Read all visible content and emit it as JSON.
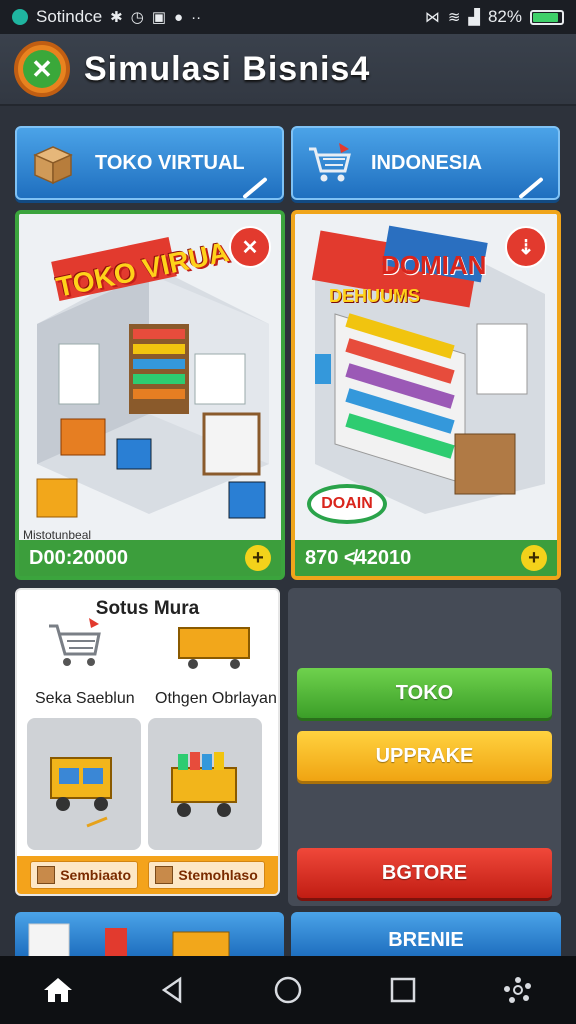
{
  "status_bar": {
    "app_name": "Sotindce",
    "battery_percent": "82%",
    "battery_level": 0.82
  },
  "app": {
    "title": "Simulasi Bisnis4"
  },
  "tabs": [
    {
      "label": "TOKO VIRTUAL",
      "icon": "box-icon"
    },
    {
      "label": "INDONESIA",
      "icon": "cart-icon"
    }
  ],
  "cards": [
    {
      "sign": "TOKO VIRUA",
      "caption": "Mistotunbeal",
      "price": "D00:20000",
      "badge": "✕"
    },
    {
      "sign": "DOMIAN",
      "sub_sign": "DEHUUMS",
      "oval": "DOAIN",
      "price": "870 ≮42010",
      "badge": "⇣"
    }
  ],
  "panel": {
    "title": "Sotus Mura",
    "left_label": "Seka Saeblun",
    "right_label": "Othgen Obrlayan",
    "footer_left": "Sembiaato",
    "footer_right": "Stemohlaso"
  },
  "actions": {
    "toko": "TOKO",
    "upgrade": "UPPRAKE",
    "store": "BGTORE"
  },
  "peek": {
    "right_label": "BRENIE"
  },
  "colors": {
    "primary_blue": "#1f6fbf",
    "accent_green": "#3ba43d",
    "accent_orange": "#f0a51b",
    "danger_red": "#e23a2e"
  }
}
